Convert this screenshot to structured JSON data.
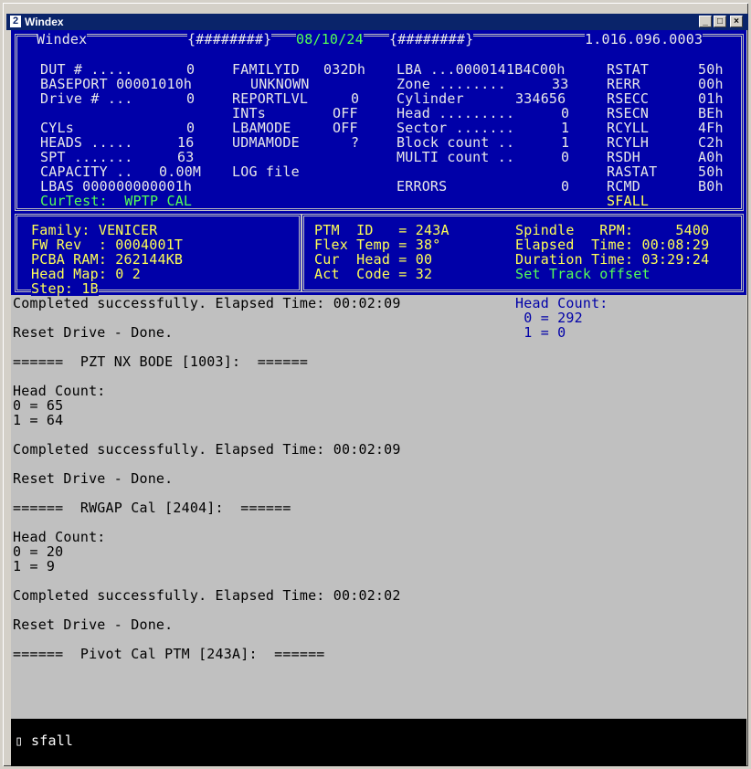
{
  "window": {
    "title": "Windex",
    "icon_label": "2"
  },
  "header": {
    "title": "Windex",
    "left_marker": "{########}",
    "date": "08/10/24",
    "right_marker": "{########}",
    "version": "1.016.096.0003"
  },
  "col1": {
    "dut": "DUT # .....",
    "dut_val": "0",
    "baseport": "BASEPORT 00001010h",
    "drive": "Drive # ...",
    "drive_val": "0",
    "cyls": "CYLs",
    "cyls_val": "0",
    "heads": "HEADS .....",
    "heads_val": "16",
    "spt": "SPT .......",
    "spt_val": "63",
    "capacity": "CAPACITY ..",
    "capacity_val": "0.00M",
    "lbas": "LBAS 000000000001h",
    "curtest": "CurTest:  WPTP CAL"
  },
  "col2": {
    "familyid": "FAMILYID",
    "familyid_val": "032Dh",
    "unknown": "UNKNOWN",
    "reportlvl": "REPORTLVL",
    "reportlvl_val": "0",
    "ints": "INTs",
    "ints_val": "OFF",
    "lbamode": "LBAMODE",
    "lbamode_val": "OFF",
    "udmamode": "UDMAMODE",
    "udmamode_val": "?",
    "logfile": "LOG file"
  },
  "col3": {
    "lba": "LBA ...0000141B4C00h",
    "zone": "Zone ........",
    "zone_val": "33",
    "cylinder": "Cylinder",
    "cylinder_val": "334656",
    "head": "Head .........",
    "head_val": "0",
    "sector": "Sector .......",
    "sector_val": "1",
    "blockcount": "Block count ..",
    "blockcount_val": "1",
    "multicount": "MULTI count ..",
    "multicount_val": "0",
    "errors": "ERRORS",
    "errors_val": "0"
  },
  "col4": {
    "rstat": "RSTAT",
    "rstat_val": "50h",
    "rerr": "RERR",
    "rerr_val": "00h",
    "rsecc": "RSECC",
    "rsecc_val": "01h",
    "rsecn": "RSECN",
    "rsecn_val": "BEh",
    "rcyll": "RCYLL",
    "rcyll_val": "4Fh",
    "rcylh": "RCYLH",
    "rcylh_val": "C2h",
    "rsdh": "RSDH",
    "rsdh_val": "A0h",
    "rastat": "RASTAT",
    "rastat_val": "50h",
    "rcmd": "RCMD",
    "rcmd_val": "B0h",
    "sfall": "SFALL"
  },
  "info_left": {
    "family": "Family: VENICER",
    "fwrev": "FW Rev  : 0004001T",
    "pcba": "PCBA RAM: 262144KB",
    "headmap": "Head Map: 0 2",
    "step": "Step: 1B"
  },
  "info_right": {
    "ptm": "PTM  ID   = 243A",
    "flex": "Flex Temp = 38°",
    "cur": "Cur  Head = 00",
    "act": "Act  Code = 32",
    "spindle": "Spindle   RPM:     5400",
    "elapsed": "Elapsed  Time: 00:08:29",
    "duration": "Duration Time: 03:29:24",
    "settrack": "Set Track offset"
  },
  "log": {
    "lines": [
      "Completed successfully. Elapsed Time: 00:02:09",
      "",
      "Reset Drive - Done.",
      "",
      "======  PZT NX BODE [1003]:  ======",
      "",
      "Head Count:",
      "0 = 65",
      "1 = 64",
      "",
      "Completed successfully. Elapsed Time: 00:02:09",
      "",
      "Reset Drive - Done.",
      "",
      "======  RWGAP Cal [2404]:  ======",
      "",
      "Head Count:",
      "0 = 20",
      "1 = 9",
      "",
      "Completed successfully. Elapsed Time: 00:02:02",
      "",
      "Reset Drive - Done.",
      "",
      "======  Pivot Cal PTM [243A]:  ======"
    ],
    "side_title": "Head Count:",
    "side_lines": [
      " 0 = 292",
      " 1 = 0"
    ]
  },
  "command": {
    "prompt": "▯",
    "text": "sfall"
  }
}
